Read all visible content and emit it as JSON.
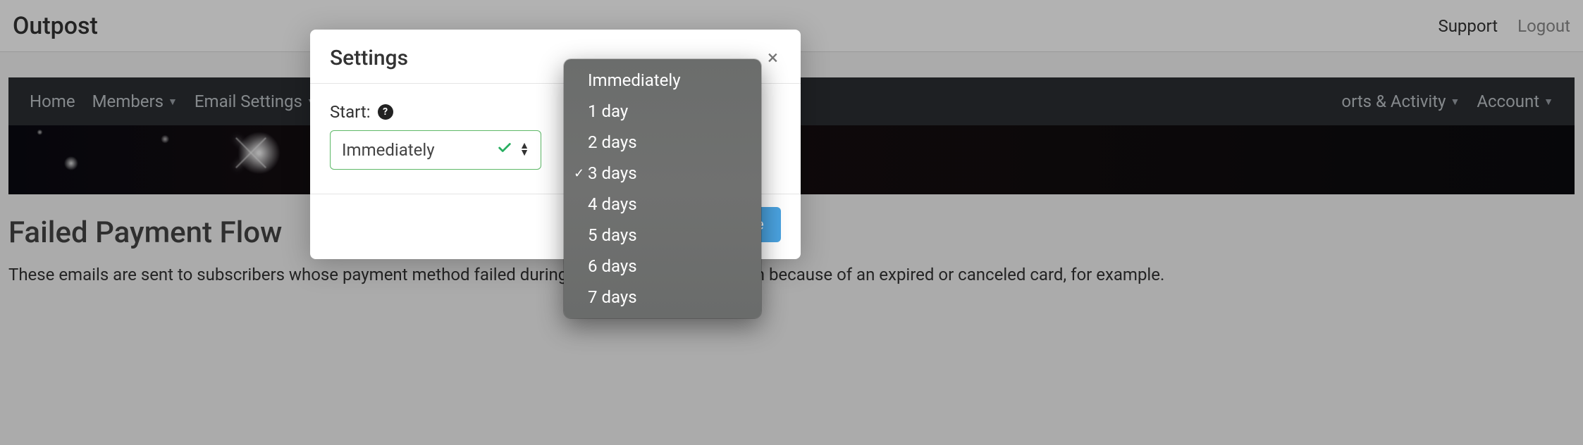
{
  "header": {
    "brand": "Outpost",
    "support": "Support",
    "logout": "Logout"
  },
  "nav": {
    "items": [
      {
        "label": "Home",
        "has_caret": false
      },
      {
        "label": "Members",
        "has_caret": true
      },
      {
        "label": "Email Settings",
        "has_caret": true
      },
      {
        "label": "orts & Activity",
        "has_caret": true
      },
      {
        "label": "Account",
        "has_caret": true
      }
    ]
  },
  "page": {
    "title": "Failed Payment Flow",
    "description": "These emails are sent to subscribers whose payment method failed during renewal. That can happen because of an expired or canceled card, for example."
  },
  "modal": {
    "title": "Settings",
    "close_glyph": "×",
    "field_label": "Start:",
    "help_glyph": "?",
    "select_value": "Immediately",
    "save_label": "Save"
  },
  "dropdown": {
    "options": [
      {
        "label": "Immediately",
        "selected": false
      },
      {
        "label": "1 day",
        "selected": false
      },
      {
        "label": "2 days",
        "selected": false
      },
      {
        "label": "3 days",
        "selected": true
      },
      {
        "label": "4 days",
        "selected": false
      },
      {
        "label": "5 days",
        "selected": false
      },
      {
        "label": "6 days",
        "selected": false
      },
      {
        "label": "7 days",
        "selected": false
      }
    ]
  }
}
